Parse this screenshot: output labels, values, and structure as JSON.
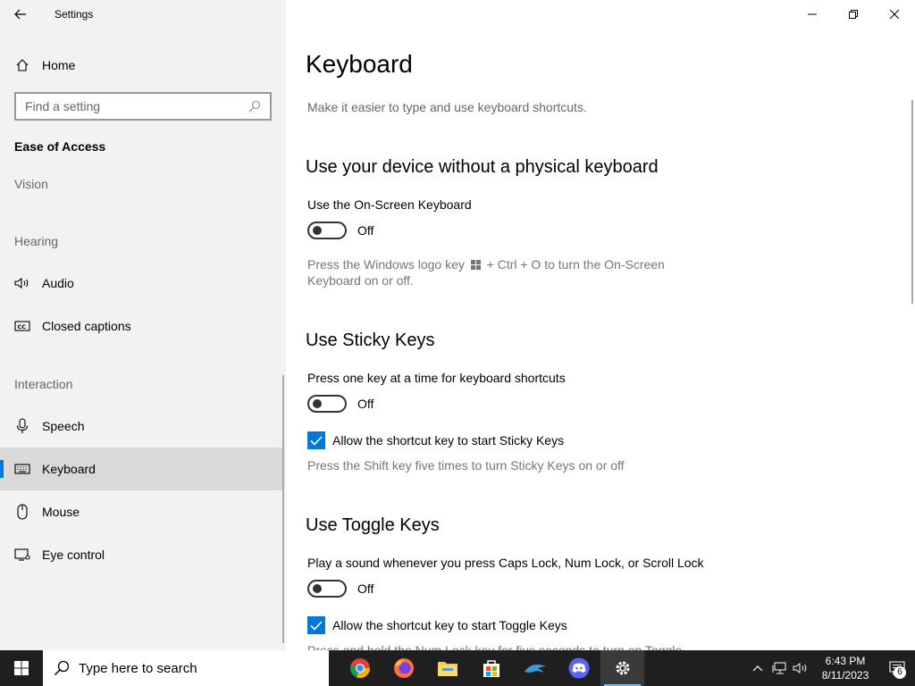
{
  "window": {
    "title": "Settings"
  },
  "sidebar": {
    "home_label": "Home",
    "search_placeholder": "Find a setting",
    "section_title": "Ease of Access",
    "groups": {
      "vision": "Vision",
      "hearing": "Hearing",
      "interaction": "Interaction"
    },
    "items": {
      "audio": "Audio",
      "closed_captions": "Closed captions",
      "speech": "Speech",
      "keyboard": "Keyboard",
      "mouse": "Mouse",
      "eye_control": "Eye control"
    },
    "selected": "keyboard"
  },
  "main": {
    "title": "Keyboard",
    "description": "Make it easier to type and use keyboard shortcuts.",
    "onscreen": {
      "heading": "Use your device without a physical keyboard",
      "label": "Use the On-Screen Keyboard",
      "toggle_state": "Off",
      "hint_part1": "Press the Windows logo key",
      "hint_part2": "+ Ctrl + O to turn the On-Screen",
      "hint_line2": "Keyboard on or off."
    },
    "sticky": {
      "heading": "Use Sticky Keys",
      "label": "Press one key at a time for keyboard shortcuts",
      "toggle_state": "Off",
      "checkbox_label": "Allow the shortcut key to start Sticky Keys",
      "checkbox_checked": true,
      "hint": "Press the Shift key five times to turn Sticky Keys on or off"
    },
    "toggle_keys": {
      "heading": "Use Toggle Keys",
      "label": "Play a sound whenever you press Caps Lock, Num Lock, or Scroll Lock",
      "toggle_state": "Off",
      "checkbox_label": "Allow the shortcut key to start Toggle Keys",
      "checkbox_checked": true,
      "hint_partial": "Press and hold the Num Lock key for five seconds to turn on Toggle"
    }
  },
  "taskbar": {
    "search_placeholder": "Type here to search",
    "apps": [
      "chrome-icon",
      "firefox-icon",
      "file-explorer-icon",
      "store-icon",
      "dolphin-icon",
      "discord-icon",
      "settings-icon"
    ],
    "active_app": "settings-icon",
    "time": "6:43 PM",
    "date": "8/11/2023",
    "notification_count": "6"
  },
  "colors": {
    "accent": "#0078d7",
    "sidebar_bg": "#f2f2f2",
    "selected_bg": "#d9d9d9",
    "taskbar_bg": "#1f1f1f"
  }
}
